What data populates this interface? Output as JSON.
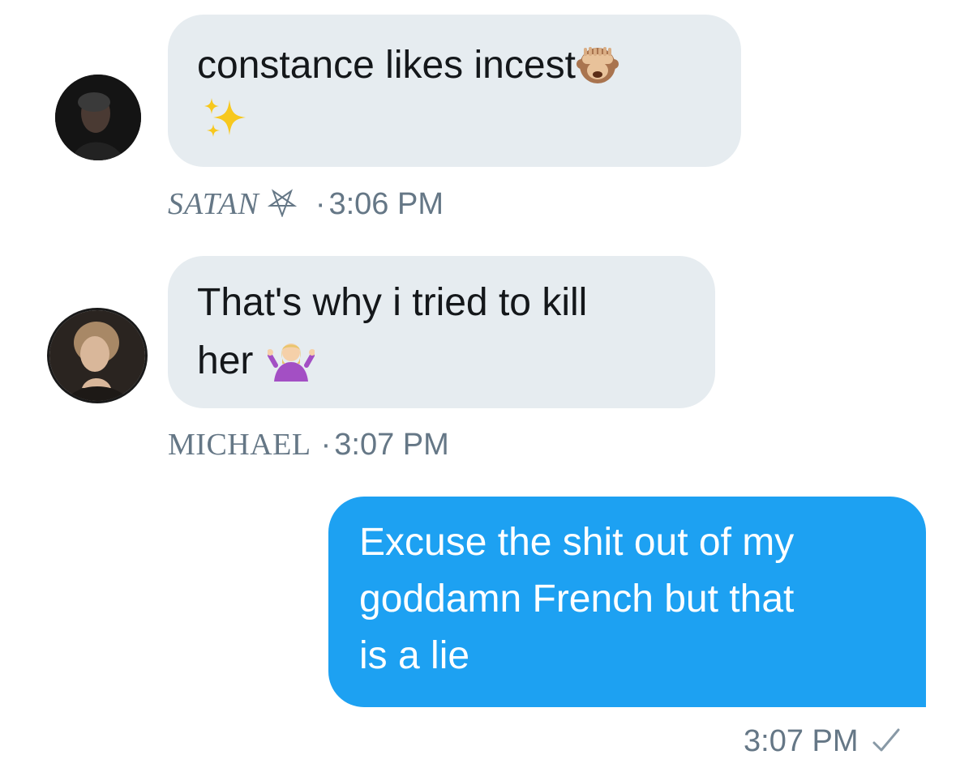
{
  "messages": [
    {
      "text": "constance likes incest",
      "emoji_inline": "see-no-evil-monkey-icon",
      "emoji_next_line": "sparkles-icon",
      "sender": "SATAN",
      "sender_icon": "pentagram-icon",
      "separator": "·",
      "time": "3:06 PM"
    },
    {
      "text_line1": "That's why i tried to kill",
      "text_line2": "her",
      "emoji_inline": "person-shrugging-icon",
      "sender": "MICHAEL",
      "separator": "·",
      "time": "3:07 PM"
    },
    {
      "lines": [
        "Excuse the shit out of my",
        "goddamn French but that",
        "is a lie"
      ],
      "time": "3:07 PM",
      "status_icon": "checkmark-icon"
    }
  ],
  "colors": {
    "incoming_bubble": "#e6ecf0",
    "outgoing_bubble": "#1da1f2",
    "meta_text": "#657786"
  }
}
